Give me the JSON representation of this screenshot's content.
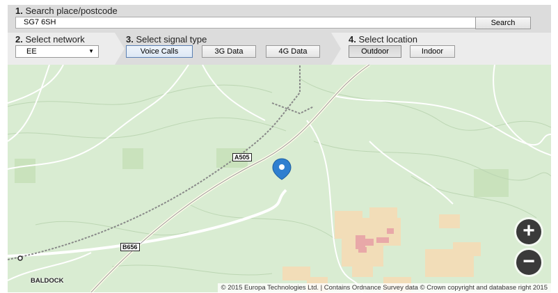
{
  "step1": {
    "number": "1.",
    "title": "Search place/postcode",
    "search_value": "SG7 6SH",
    "search_button": "Search"
  },
  "step2": {
    "number": "2.",
    "title": "Select network",
    "network_selected": "EE"
  },
  "step3": {
    "number": "3.",
    "title": "Select signal type",
    "options": [
      "Voice Calls",
      "3G Data",
      "4G Data"
    ],
    "active": "Voice Calls"
  },
  "step4": {
    "number": "4.",
    "title": "Select location",
    "options": [
      "Outdoor",
      "Indoor"
    ],
    "active": "Outdoor"
  },
  "map": {
    "road_labels": [
      "A505",
      "B656"
    ],
    "place_labels": [
      "BALDOCK"
    ],
    "zoom_in": "+",
    "zoom_out": "−",
    "attribution": "© 2015 Europa Technologies Ltd. | Contains Ordnance Survey data © Crown copyright and database right 2015",
    "colors": {
      "land": "#d9ecd2",
      "road": "#ffffff",
      "pin": "#2f7fd0",
      "urban": "#f2ddb8",
      "urban_dense": "#e8a8a8"
    }
  }
}
